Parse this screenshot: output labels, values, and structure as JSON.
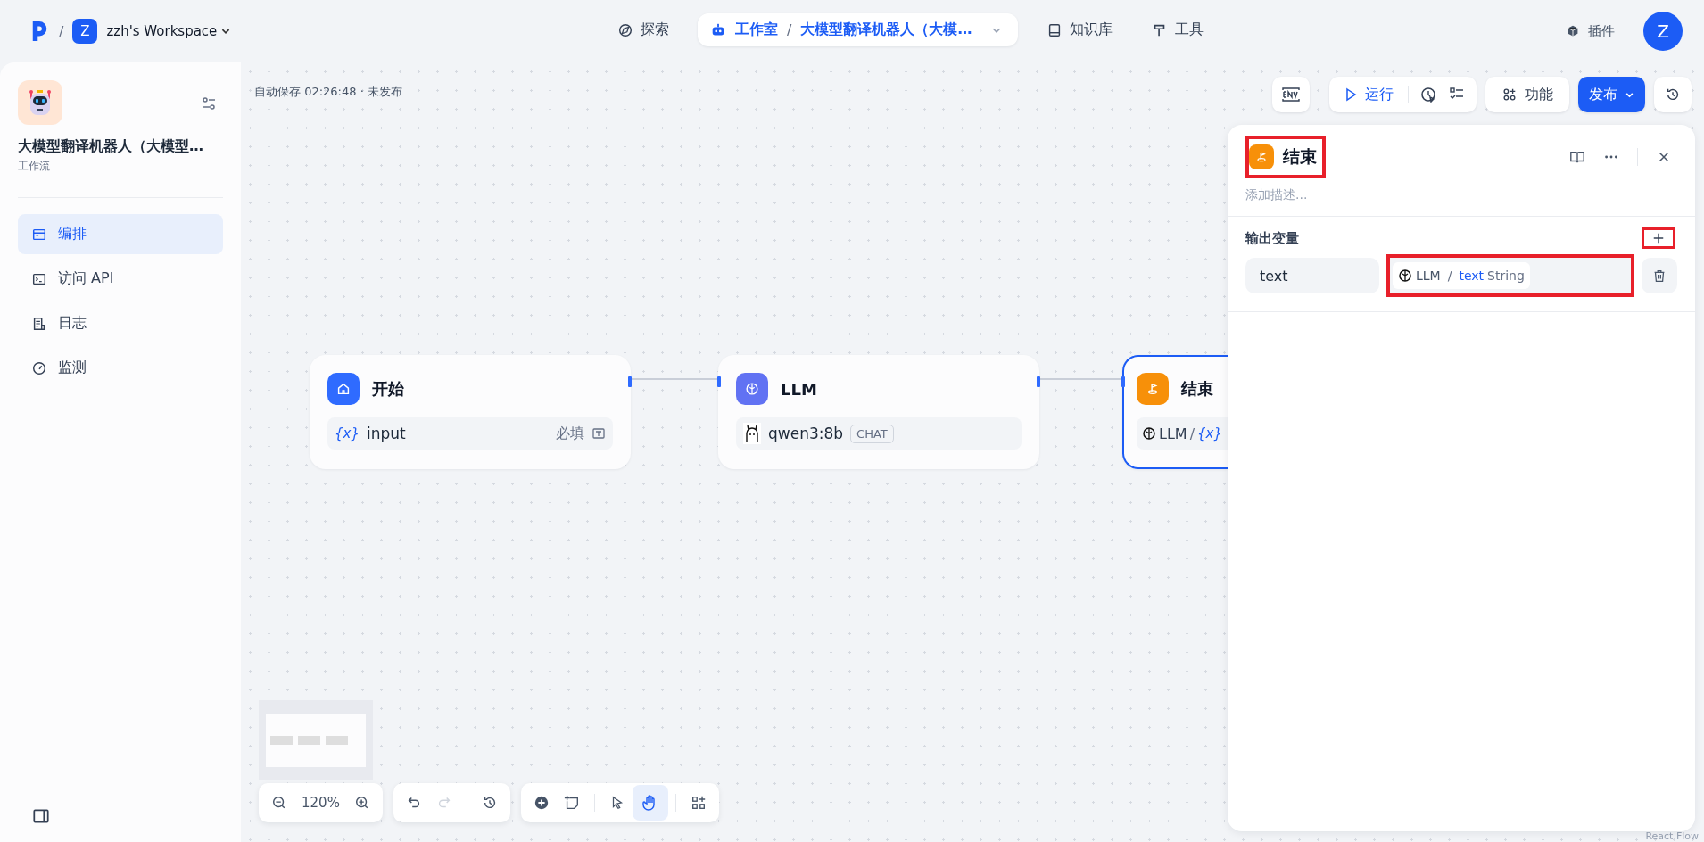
{
  "top_bar": {
    "separator": "/",
    "workspace": {
      "avatar": "Z",
      "name": "zzh's Workspace"
    },
    "nav": [
      {
        "kind": "explore",
        "label": "探索",
        "selected": false
      },
      {
        "kind": "studio",
        "label": "工作室",
        "selected": true,
        "sep": "/",
        "app_name": "大模型翻译机器人（大模…"
      },
      {
        "kind": "knowledge",
        "label": "知识库",
        "selected": false
      },
      {
        "kind": "tools",
        "label": "工具",
        "selected": false
      }
    ],
    "plugins": "插件",
    "avatar": "Z"
  },
  "sidebar": {
    "app_title": "大模型翻译机器人（大模型…",
    "app_type": "工作流",
    "items": [
      {
        "kind": "layout",
        "label": "编排",
        "selected": true
      },
      {
        "kind": "api",
        "label": "访问 API",
        "selected": false
      },
      {
        "kind": "log",
        "label": "日志",
        "selected": false
      },
      {
        "kind": "monitor",
        "label": "监测",
        "selected": false
      }
    ]
  },
  "canvas": {
    "autosave": "自动保存 02:26:48 · 未发布",
    "toolbar": {
      "run": "运行",
      "features": "功能",
      "publish": "发布"
    },
    "zoom": "120%",
    "nodes": [
      {
        "kind": "start",
        "title": "开始",
        "selected": false,
        "var_mark": "{x}",
        "param": "input",
        "required": "必填"
      },
      {
        "kind": "llm",
        "title": "LLM",
        "selected": false,
        "model": "qwen3:8b",
        "tag": "CHAT"
      },
      {
        "kind": "end",
        "title": "结束",
        "selected": true,
        "source": "LLM",
        "sep": "/",
        "var_mark": "{x}"
      }
    ],
    "attribution": "React Flow"
  },
  "panel": {
    "title": "结束",
    "description_placeholder": "添加描述...",
    "section": "输出变量",
    "outputs": [
      {
        "name": "text",
        "source": "LLM",
        "sep": "/",
        "variable": "text",
        "type": "String"
      }
    ]
  }
}
